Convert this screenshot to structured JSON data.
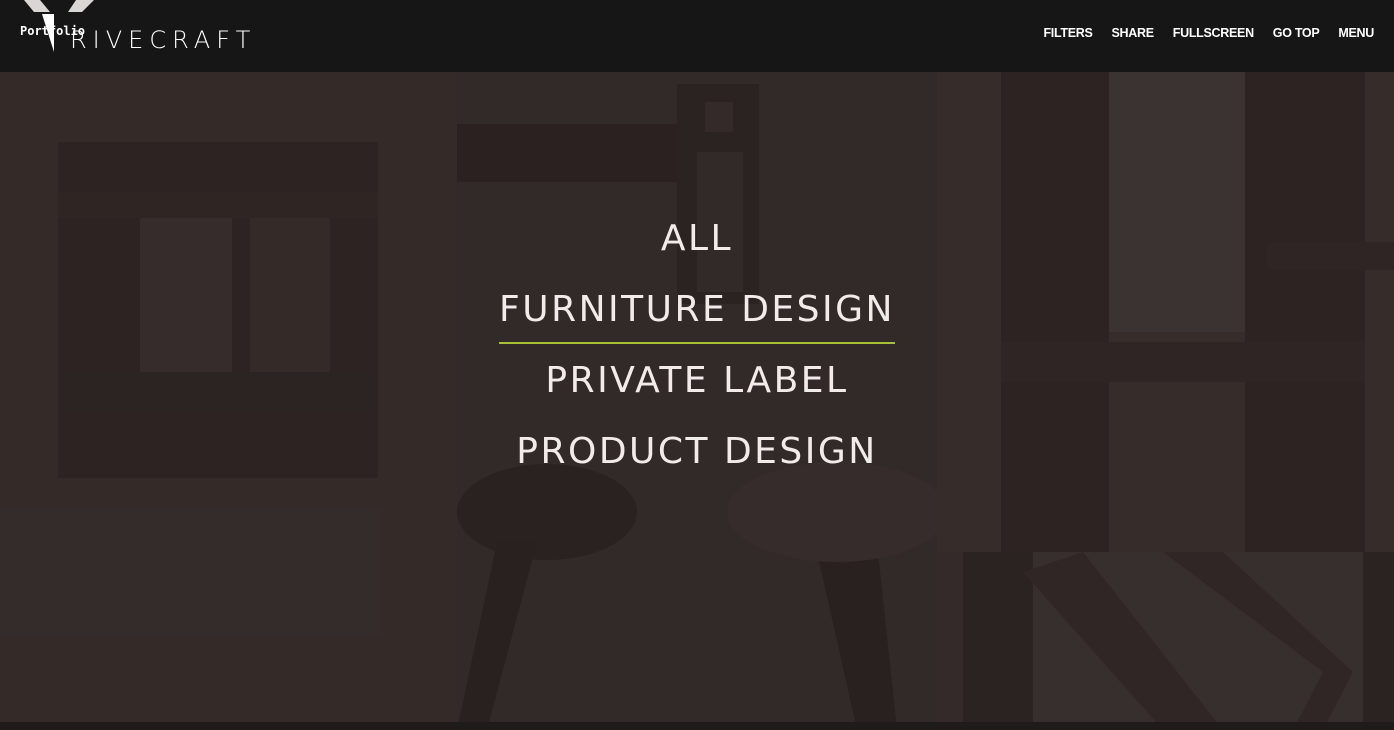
{
  "brand": {
    "logo_text": "RIVECRAFT",
    "tag": "Portfolio"
  },
  "nav": {
    "items": [
      "FILTERS",
      "SHARE",
      "FULLSCREEN",
      "GO TOP",
      "MENU"
    ]
  },
  "filters": {
    "items": [
      "ALL",
      "FURNITURE DESIGN",
      "PRIVATE LABEL",
      "PRODUCT DESIGN"
    ],
    "active_index": 1
  },
  "colors": {
    "header_bg": "#171616",
    "accent": "#a7c133",
    "overlay": "#3a3230",
    "text": "#f1ecea"
  }
}
